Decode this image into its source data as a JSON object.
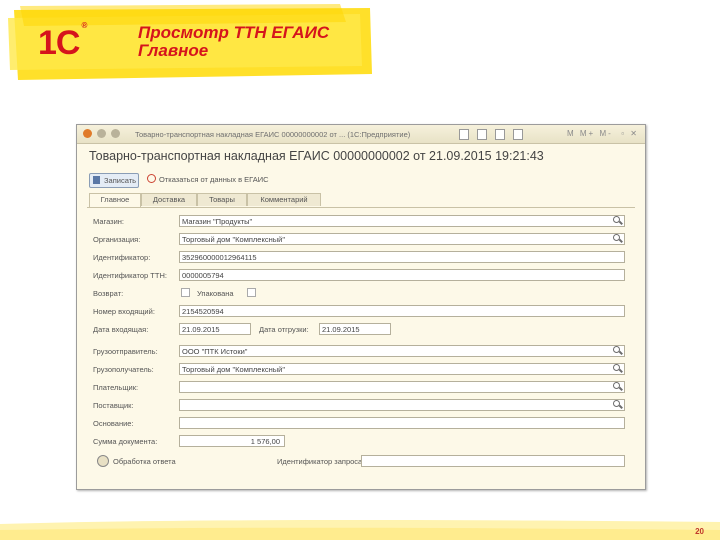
{
  "slide": {
    "logo": "1С",
    "title_line1": "Просмотр ТТН ЕГАИС",
    "title_line2": "Главное",
    "page_number": "20"
  },
  "window": {
    "title": "Товарно-транспортная накладная ЕГАИС 00000000002 от ... (1С:Предприятие)",
    "title_buttons": "M M+ M-",
    "header": "Товарно-транспортная накладная ЕГАИС 00000000002 от 21.09.2015 19:21:43",
    "toolbar": {
      "write": "Записать",
      "unpost": "Отказаться от данных в ЕГАИС"
    },
    "tabs": [
      "Главное",
      "Доставка",
      "Товары",
      "Комментарий"
    ],
    "fields": {
      "shop_label": "Магазин:",
      "shop_value": "Магазин \"Продукты\"",
      "org_label": "Организация:",
      "org_value": "Торговый дом \"Комплексный\"",
      "id_label": "Идентификатор:",
      "id_value": "352960000012964115",
      "ttn_id_label": "Идентификатор ТТН:",
      "ttn_id_value": "0000005794",
      "return_label": "Возврат:",
      "packed_label": "Упакована",
      "incoming_num_label": "Номер входящий:",
      "incoming_num_value": "2154520594",
      "incoming_date_label": "Дата входящая:",
      "incoming_date_value": "21.09.2015",
      "ship_date_label": "Дата отгрузки:",
      "ship_date_value": "21.09.2015",
      "shipper_label": "Грузоотправитель:",
      "shipper_value": "ООО \"ПТК Истоки\"",
      "consignee_label": "Грузополучатель:",
      "consignee_value": "Торговый дом \"Комплексный\"",
      "payer_label": "Плательщик:",
      "supplier_label": "Поставщик:",
      "basis_label": "Основание:",
      "doc_sum_label": "Сумма документа:",
      "doc_sum_value": "1 576,00",
      "processing_label": "Обработка ответа",
      "req_id_label": "Идентификатор запроса:"
    }
  },
  "colors": {
    "title_red": "#d5141c",
    "header_yellow": "#ffe02a",
    "window_bg": "#fdf9e8"
  }
}
